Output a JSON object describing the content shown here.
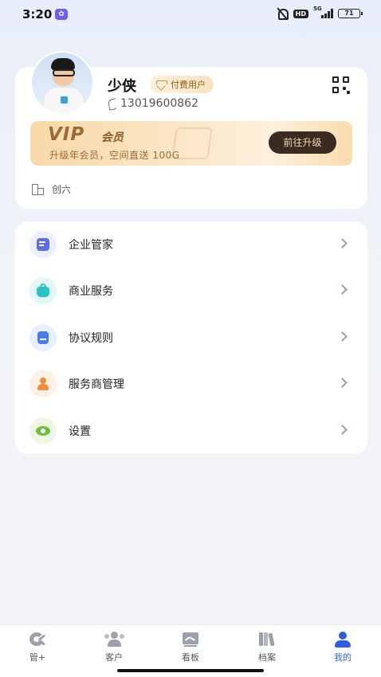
{
  "status_bar": {
    "time": "3:20",
    "hd": "HD",
    "network": "5G",
    "battery": "71"
  },
  "profile": {
    "name": "少侠",
    "badge": "付费用户",
    "phone": "13019600862",
    "org": "创六"
  },
  "vip": {
    "logo": "VIP",
    "title": "会员",
    "description": "升级年会员，空间直送 100G",
    "button": "前往升级"
  },
  "menu": {
    "items": [
      {
        "label": "企业管家",
        "icon": "enterprise-icon",
        "color": "#5b6cf0",
        "bg": "#eceffe"
      },
      {
        "label": "商业服务",
        "icon": "business-bag-icon",
        "color": "#2bc4c4",
        "bg": "#e4f7f7"
      },
      {
        "label": "协议规则",
        "icon": "document-icon",
        "color": "#4a7af0",
        "bg": "#e8effd"
      },
      {
        "label": "服务商管理",
        "icon": "provider-person-icon",
        "color": "#f08a3c",
        "bg": "#fdf0e5"
      },
      {
        "label": "设置",
        "icon": "settings-eye-icon",
        "color": "#6fbf3a",
        "bg": "#eef7e6"
      }
    ]
  },
  "bottom_nav": {
    "tabs": [
      {
        "label": "管+",
        "icon": "manage-plus-icon",
        "active": false
      },
      {
        "label": "客户",
        "icon": "customers-icon",
        "active": false
      },
      {
        "label": "看板",
        "icon": "dashboard-icon",
        "active": false
      },
      {
        "label": "档案",
        "icon": "archive-icon",
        "active": false
      },
      {
        "label": "我的",
        "icon": "profile-icon",
        "active": true
      }
    ],
    "active_color": "#2f5fe0",
    "inactive_color": "#9aa1ad"
  }
}
